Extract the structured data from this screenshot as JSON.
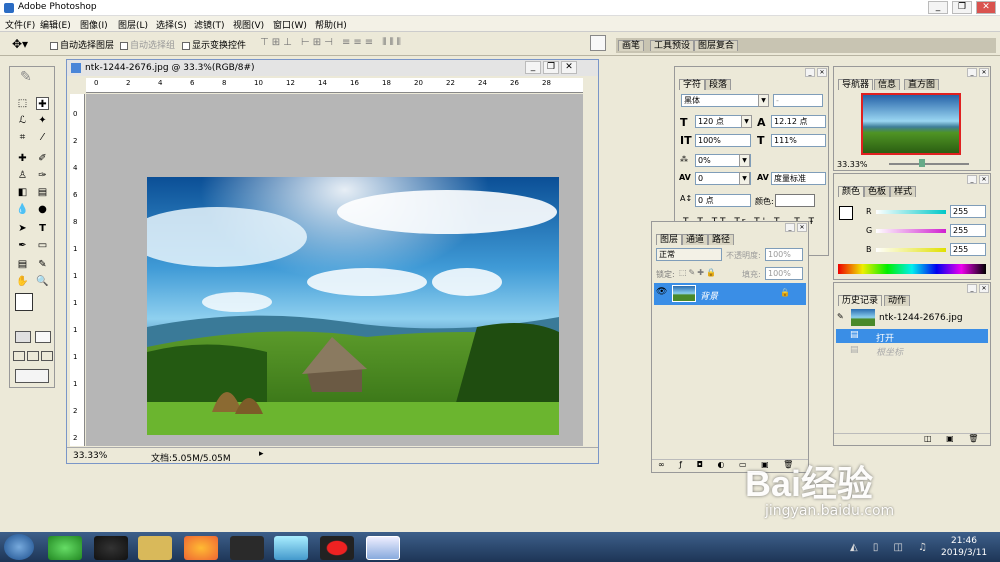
{
  "app": {
    "title": "Adobe Photoshop",
    "controls": [
      "_",
      "❐",
      "✕"
    ]
  },
  "menu": [
    "文件(F)",
    "编辑(E)",
    "图像(I)",
    "图层(L)",
    "选择(S)",
    "滤镜(T)",
    "视图(V)",
    "窗口(W)",
    "帮助(H)"
  ],
  "options": {
    "auto_select_layer": "自动选择图层",
    "auto_select_group": "自动选择组",
    "show_transform": "显示变换控件"
  },
  "wells": [
    "画笔",
    "工具预设",
    "图层复合"
  ],
  "document": {
    "title": "ntk-1244-2676.jpg @ 33.3%(RGB/8#)",
    "zoom": "33.33%",
    "doc_info": "文档:5.05M/5.05M",
    "ruler_h": [
      "0",
      "2",
      "4",
      "6",
      "8",
      "10",
      "12",
      "14",
      "16",
      "18",
      "20",
      "22",
      "24",
      "26",
      "28"
    ],
    "ruler_v": [
      "0",
      "2",
      "4",
      "6",
      "8",
      "1",
      "1",
      "1",
      "1",
      "1",
      "1",
      "2",
      "2"
    ]
  },
  "character": {
    "tabs": [
      "字符",
      "段落"
    ],
    "font": "黑体",
    "style": "-",
    "size": "120 点",
    "leading": "12.12 点",
    "vscale": "100%",
    "hscale": "111%",
    "tracking_pct": "0%",
    "kerning": "0",
    "kern_type": "度量标准",
    "baseline": "0 点",
    "color_label": "颜色:"
  },
  "layers": {
    "tabs": [
      "图层",
      "通道",
      "路径"
    ],
    "mode": "正常",
    "opacity_label": "不透明度:",
    "opacity": "100%",
    "lock_label": "锁定:",
    "fill_label": "填充:",
    "fill": "100%",
    "layer_name": "背景"
  },
  "navigator": {
    "tabs": [
      "导航器",
      "信息",
      "直方图"
    ],
    "zoom": "33.33%"
  },
  "color": {
    "tabs": [
      "颜色",
      "色板",
      "样式"
    ],
    "r_label": "R",
    "g_label": "G",
    "b_label": "B",
    "r": "255",
    "g": "255",
    "b": "255",
    "colors": {
      "r": "#00c8c8",
      "g": "#d020d0",
      "b": "#e0e000"
    }
  },
  "history": {
    "tabs": [
      "历史记录",
      "动作"
    ],
    "snapshot": "ntk-1244-2676.jpg",
    "items": [
      "打开",
      "根坐标"
    ]
  },
  "taskbar": {
    "time": "21:46",
    "date": "2019/3/11"
  },
  "watermark": {
    "text": "Bai经验",
    "url": "jingyan.baidu.com"
  }
}
